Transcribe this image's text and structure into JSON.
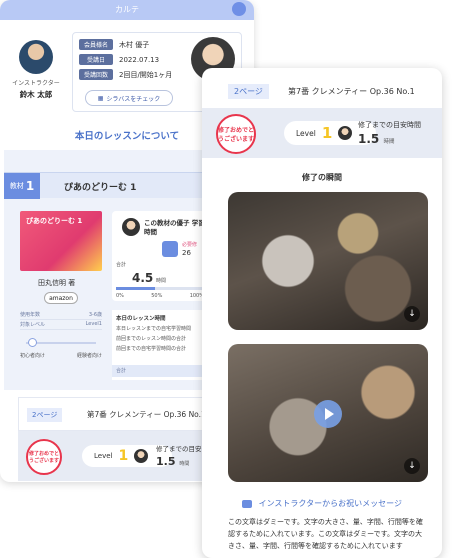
{
  "back": {
    "header_title": "カルテ",
    "instructor": {
      "role": "インストラクター",
      "name": "鈴木 太郎"
    },
    "member": [
      {
        "label": "会員様名",
        "value": "木村 優子"
      },
      {
        "label": "受講日",
        "value": "2022.07.13"
      },
      {
        "label": "受講回数",
        "value": "2回目/開始1ヶ月"
      }
    ],
    "syllabus_button": "シラバスをチェック",
    "lesson_title": "本日のレッスンについて",
    "material": {
      "tag": "教材",
      "number": "1",
      "name": "ぴあのどりーむ 1"
    },
    "book": {
      "cover_title": "ぴあのどりーむ 1",
      "author": "田丸信明 著",
      "amazon": "amazon"
    },
    "stats": [
      {
        "label": "使用年数",
        "value": "3-6歳"
      },
      {
        "label": "対象レベル",
        "value": "Level1"
      }
    ],
    "level_ends": [
      "初心者向け",
      "経験者向け"
    ],
    "preferred": {
      "title": "この教材の優子 学習時間",
      "sub": "必要修",
      "num": "26",
      "total_label": "合計",
      "hours": "4.5",
      "unit": "時間",
      "progress_percent": 45,
      "scale": [
        "0%",
        "50%",
        "100%"
      ]
    },
    "history": {
      "title": "本日のレッスン時間",
      "lines": [
        "本日レッスンまでの自宅学習時間",
        "前回までのレッスン時間の合計",
        "前回までの自宅学習時間の合計"
      ],
      "footer": "合計"
    },
    "page_bar": {
      "tag": "2ページ",
      "song": "第7番 クレメンティー Op.36 No.1"
    },
    "done": {
      "seal": "修了おめでとうございます",
      "level_label": "Level",
      "level_value": "1",
      "goal_label": "修了までの目安",
      "goal_value": "1.5",
      "goal_unit": "時間"
    }
  },
  "front": {
    "page_tag": "2ページ",
    "song": "第7番 クレメンティー Op.36 No.1",
    "seal": "修了おめでとうございます",
    "level_label": "Level",
    "level_value": "1",
    "goal_label": "修了までの目安時間",
    "goal_value": "1.5",
    "goal_unit": "時間",
    "moment_title": "修了の瞬間",
    "message_title": "インストラクターからお祝いメッセージ",
    "message_body": "この文章はダミーです。文字の大きさ、量、字間、行間等を確認するために入れています。この文章はダミーです。文字の大きさ、量、字間、行間等を確認するために入れています"
  }
}
